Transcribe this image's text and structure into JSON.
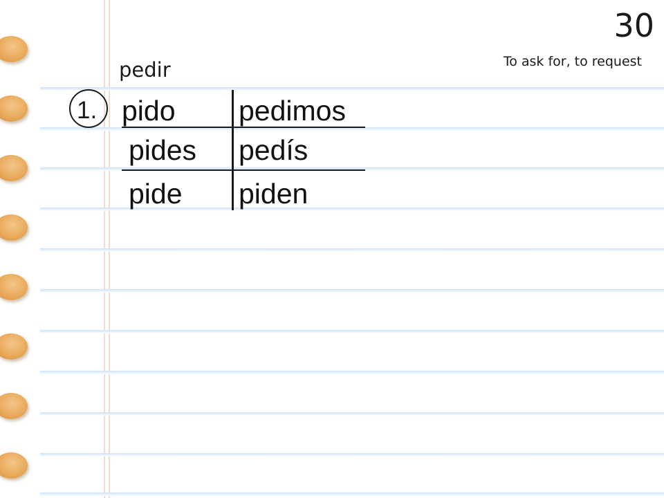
{
  "slide": {
    "page_number": "30",
    "meaning": "To ask for, to request",
    "verb": "pedir",
    "item_number": "1.",
    "conjugation": {
      "yo": "pido",
      "nosotros": "pedimos",
      "tu": "pides",
      "vosotros": "pedís",
      "el": "pide",
      "ellos": "piden"
    }
  },
  "colors": {
    "rule_line": "#cfe4f7",
    "binder_hole": "#e9a95a",
    "text": "#1a1a1a"
  }
}
